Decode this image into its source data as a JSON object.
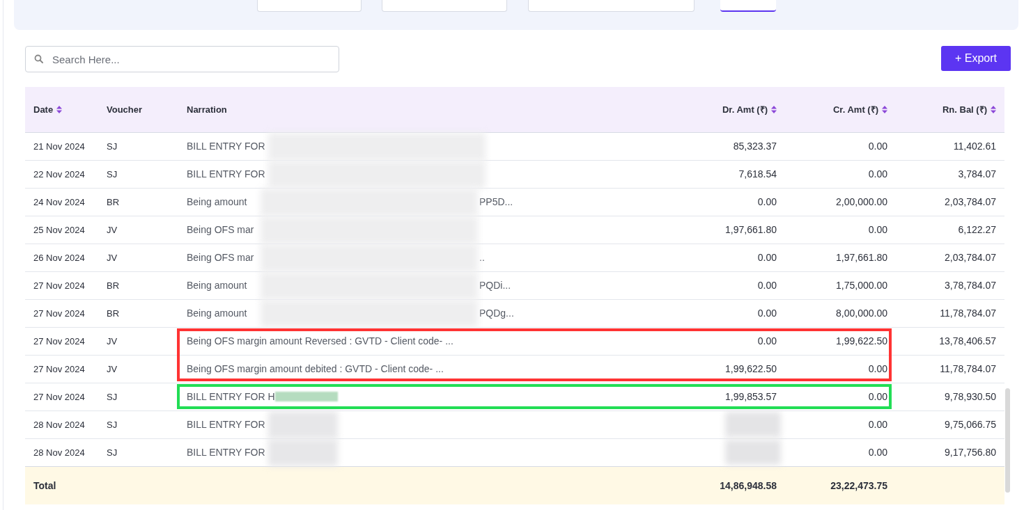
{
  "search": {
    "placeholder": "Search Here..."
  },
  "export_button": {
    "label": "+ Export"
  },
  "table": {
    "columns": [
      {
        "label": "Date",
        "sortable": true
      },
      {
        "label": "Voucher",
        "sortable": false
      },
      {
        "label": "Narration",
        "sortable": false
      },
      {
        "label": "Dr. Amt (₹)",
        "sortable": true
      },
      {
        "label": "Cr. Amt (₹)",
        "sortable": true
      },
      {
        "label": "Rn. Bal (₹)",
        "sortable": true
      }
    ],
    "rows": [
      {
        "date": "21 Nov 2024",
        "voucher": "SJ",
        "narration": "BILL ENTRY FOR",
        "narration_redacted": true,
        "dr_amt": "85,323.37",
        "cr_amt": "0.00",
        "balance": "11,402.61"
      },
      {
        "date": "22 Nov 2024",
        "voucher": "SJ",
        "narration": "BILL ENTRY FOR",
        "narration_redacted": true,
        "dr_amt": "7,618.54",
        "cr_amt": "0.00",
        "balance": "3,784.07"
      },
      {
        "date": "24 Nov 2024",
        "voucher": "BR",
        "narration": "Being amount",
        "narration_redacted": true,
        "narration_tail": "PP5D...",
        "dr_amt": "0.00",
        "cr_amt": "2,00,000.00",
        "balance": "2,03,784.07"
      },
      {
        "date": "25 Nov 2024",
        "voucher": "JV",
        "narration": "Being OFS mar",
        "narration_redacted": true,
        "dr_amt": "1,97,661.80",
        "cr_amt": "0.00",
        "balance": "6,122.27"
      },
      {
        "date": "26 Nov 2024",
        "voucher": "JV",
        "narration": "Being OFS mar",
        "narration_redacted": true,
        "narration_tail": "..",
        "dr_amt": "0.00",
        "cr_amt": "1,97,661.80",
        "balance": "2,03,784.07"
      },
      {
        "date": "27 Nov 2024",
        "voucher": "BR",
        "narration": "Being amount",
        "narration_redacted": true,
        "narration_tail": "PQDi...",
        "dr_amt": "0.00",
        "cr_amt": "1,75,000.00",
        "balance": "3,78,784.07"
      },
      {
        "date": "27 Nov 2024",
        "voucher": "BR",
        "narration": "Being amount",
        "narration_redacted": true,
        "narration_tail": "PQDg...",
        "dr_amt": "0.00",
        "cr_amt": "8,00,000.00",
        "balance": "11,78,784.07"
      },
      {
        "date": "27 Nov 2024",
        "voucher": "JV",
        "narration": "Being OFS margin amount Reversed : GVTD - Client code- ...",
        "dr_amt": "0.00",
        "cr_amt": "1,99,622.50",
        "balance": "13,78,406.57",
        "color": "#ff3333"
      },
      {
        "date": "27 Nov 2024",
        "voucher": "JV",
        "narration": "Being OFS margin amount debited : GVTD - Client code- ...",
        "dr_amt": "1,99,622.50",
        "cr_amt": "0.00",
        "balance": "11,78,784.07",
        "color": "#ff3333"
      },
      {
        "date": "27 Nov 2024",
        "voucher": "SJ",
        "narration": "BILL ENTRY FOR H",
        "narration_redacted": true,
        "dr_amt": "1,99,853.57",
        "cr_amt": "0.00",
        "balance": "9,78,930.50",
        "color": "#22dd55"
      },
      {
        "date": "28 Nov 2024",
        "voucher": "SJ",
        "narration": "BILL ENTRY FOR",
        "narration_redacted": true,
        "dr_blurred": true,
        "cr_amt": "0.00",
        "balance": "9,75,066.75"
      },
      {
        "date": "28 Nov 2024",
        "voucher": "SJ",
        "narration": "BILL ENTRY FOR",
        "narration_redacted": true,
        "dr_blurred": true,
        "cr_amt": "0.00",
        "balance": "9,17,756.80"
      }
    ],
    "total": {
      "label": "Total",
      "dr_amt": "14,86,948.58",
      "cr_amt": "23,22,473.75"
    }
  }
}
